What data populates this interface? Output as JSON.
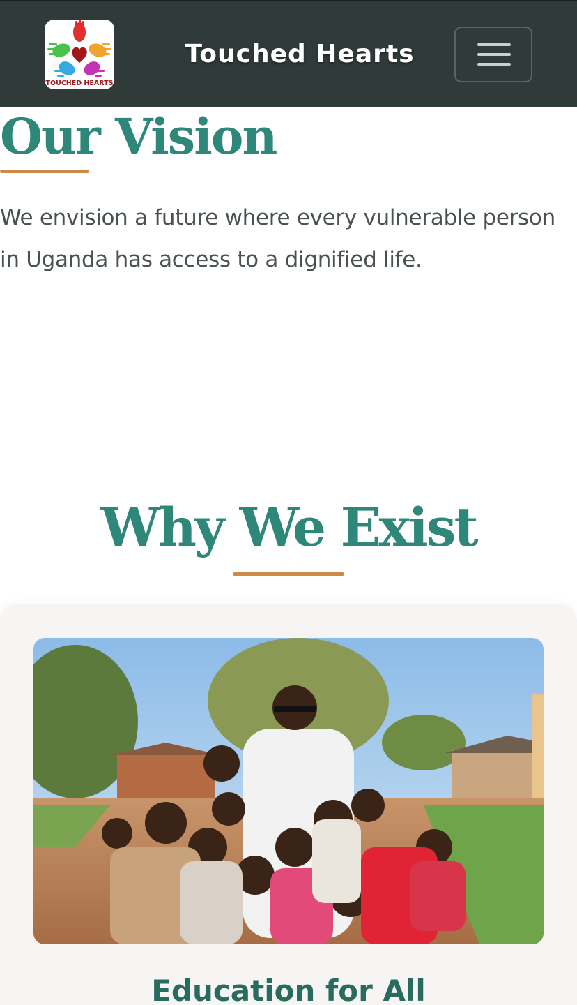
{
  "header": {
    "brand": "Touched Hearts",
    "logo_text": "TOUCHED HEARTS",
    "menu_icon": "hamburger-menu-icon",
    "background_color": "#2f3a39"
  },
  "vision": {
    "title": "Our Vision",
    "text": "We envision a future where every vulnerable person in Uganda has access to a dignified life."
  },
  "why": {
    "title": "Why We Exist",
    "card": {
      "image": "photo of smiling children gathered around a man in a white shirt in a village",
      "title": "Education for All"
    }
  },
  "colors": {
    "heading": "#2e8778",
    "accent_underline": "#cd8a45",
    "body_text": "#4a5251",
    "card_background": "#f6f5f3"
  }
}
